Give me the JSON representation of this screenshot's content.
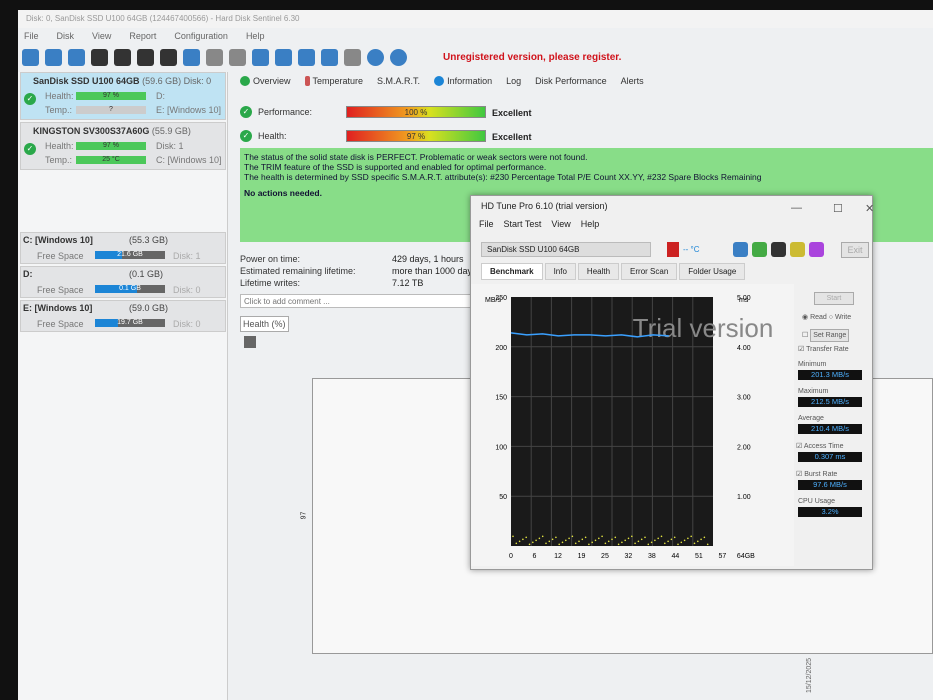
{
  "window": {
    "title": "Disk: 0, SanDisk SSD U100 64GB (124467400566) - Hard Disk Sentinel 6.30",
    "menu": [
      "File",
      "Disk",
      "View",
      "Report",
      "Configuration",
      "Help"
    ],
    "unregistered": "Unregistered version, please register."
  },
  "disks": [
    {
      "name": "SanDisk SSD U100 64GB",
      "size": "(59.6 GB)",
      "disk": "Disk: 0",
      "health_label": "Health:",
      "health": "97 %",
      "health_pct": 97,
      "temp_label": "Temp.:",
      "temp": "?",
      "drive1": "D:",
      "drive2": "E: [Windows 10]"
    },
    {
      "name": "KINGSTON SV300S37A60G",
      "size": "(55.9 GB)",
      "disk": "",
      "health_label": "Health:",
      "health": "97 %",
      "health_pct": 97,
      "temp_label": "Temp.:",
      "temp": "25 °C",
      "drive1": "Disk: 1",
      "drive2": "C: [Windows 10]"
    }
  ],
  "partitions": [
    {
      "name": "C: [Windows 10]",
      "size": "(55.3 GB)",
      "free_label": "Free Space",
      "free": "21.6 GB",
      "free_pct": 39,
      "disk": "Disk: 1"
    },
    {
      "name": "D:",
      "size": "(0.1 GB)",
      "free_label": "Free Space",
      "free": "0.1 GB",
      "free_pct": 60,
      "disk": "Disk: 0"
    },
    {
      "name": "E: [Windows 10]",
      "size": "(59.0 GB)",
      "free_label": "Free Space",
      "free": "19.7 GB",
      "free_pct": 33,
      "disk": "Disk: 0"
    }
  ],
  "tabs": [
    "Overview",
    "Temperature",
    "S.M.A.R.T.",
    "Information",
    "Log",
    "Disk Performance",
    "Alerts"
  ],
  "overview": {
    "performance_label": "Performance:",
    "performance": "100 %",
    "performance_rating": "Excellent",
    "health_label": "Health:",
    "health": "97 %",
    "health_rating": "Excellent",
    "status_lines": [
      "The status of the solid state disk is PERFECT. Problematic or weak sectors were not found.",
      "The TRIM feature of the SSD is supported and enabled for optimal performance.",
      "The health is determined by SSD specific S.M.A.R.T. attribute(s):  #230 Percentage Total P/E Count XX.YY, #232 Spare Blocks Remaining"
    ],
    "actions": "No actions needed.",
    "power_on_label": "Power on time:",
    "power_on": "429 days, 1 hours",
    "lifetime_label": "Estimated remaining lifetime:",
    "lifetime": "more than 1000 days",
    "writes_label": "Lifetime writes:",
    "writes": "7.12 TB",
    "comment_placeholder": "Click to add comment ...",
    "health_tab": "Health (%)",
    "chart_y_label": "97",
    "chart_x_label": "15/12/2025"
  },
  "hdtune": {
    "title": "HD Tune Pro 6.10 (trial version)",
    "menu": [
      "File",
      "Start Test",
      "View",
      "Help"
    ],
    "drive": "SanDisk SSD U100 64GB",
    "temp": "-- °C",
    "exit": "Exit",
    "tabs": [
      "Benchmark",
      "Info",
      "Health",
      "Error Scan",
      "Folder Usage"
    ],
    "watermark": "Trial version",
    "start": "Start",
    "read": "Read",
    "write": "Write",
    "set_range": "Set Range",
    "transfer_rate": "Transfer Rate",
    "minimum_label": "Minimum",
    "minimum": "201.3 MB/s",
    "maximum_label": "Maximum",
    "maximum": "212.5 MB/s",
    "average_label": "Average",
    "average": "210.4 MB/s",
    "access_label": "Access Time",
    "access": "0.307 ms",
    "burst_label": "Burst Rate",
    "burst": "97.6 MB/s",
    "cpu_label": "CPU Usage",
    "cpu": "3.2%"
  },
  "chart_data": {
    "type": "line",
    "title": "Benchmark",
    "ylabel": "MB/s",
    "y2label": "ms",
    "ylim": [
      0,
      250
    ],
    "y2lim": [
      0,
      5
    ],
    "yticks": [
      "250",
      "200",
      "150",
      "100",
      "50"
    ],
    "y2ticks": [
      "5.00",
      "4.00",
      "3.00",
      "2.00",
      "1.00"
    ],
    "xticks": [
      "0",
      "6",
      "12",
      "19",
      "25",
      "32",
      "38",
      "44",
      "51",
      "57",
      "64GB"
    ],
    "series": [
      {
        "name": "Transfer Rate",
        "color": "#3aa0ff",
        "x": [
          0,
          5,
          10,
          15,
          20,
          25,
          30,
          35,
          40,
          45,
          50
        ],
        "values": [
          214,
          212,
          213,
          211,
          212,
          212,
          211,
          212,
          210,
          212,
          211
        ]
      },
      {
        "name": "Access Time",
        "color": "#e0e040",
        "unit": "ms",
        "value": 0.307
      }
    ]
  }
}
